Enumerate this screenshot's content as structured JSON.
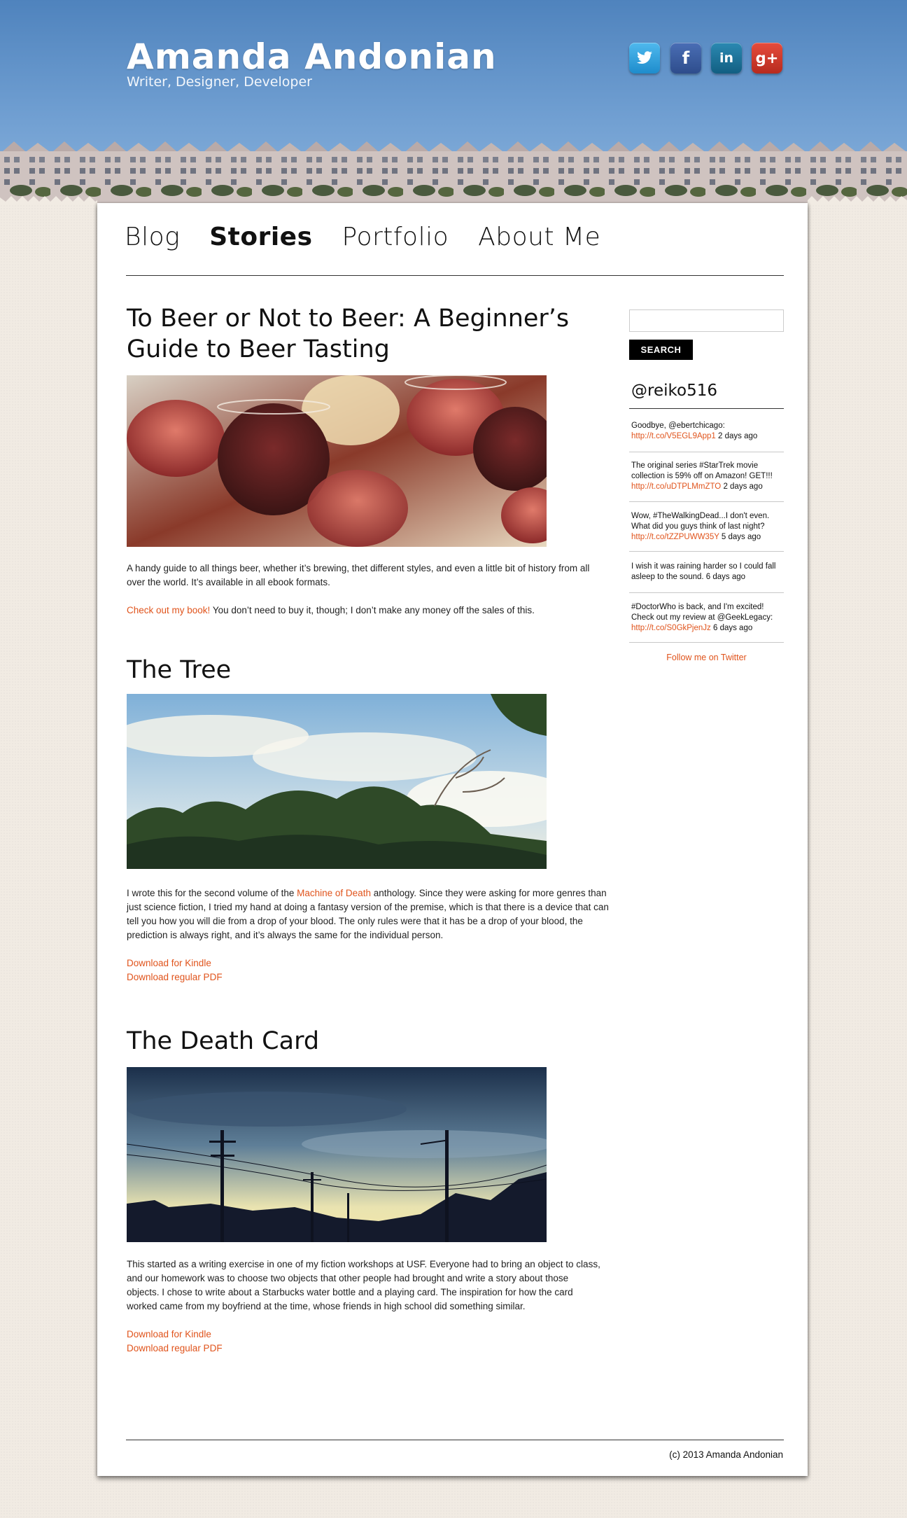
{
  "header": {
    "title": "Amanda Andonian",
    "tagline": "Writer, Designer, Developer",
    "social": [
      {
        "name": "twitter",
        "glyph": "🐦︎"
      },
      {
        "name": "facebook",
        "glyph": "f"
      },
      {
        "name": "linkedin",
        "glyph": "in"
      },
      {
        "name": "google-plus",
        "glyph": "g+"
      }
    ]
  },
  "nav": {
    "items": [
      {
        "label": "Blog"
      },
      {
        "label": "Stories"
      },
      {
        "label": "Portfolio"
      },
      {
        "label": "About Me"
      }
    ],
    "active": "Stories"
  },
  "posts": [
    {
      "title": "To Beer or Not to Beer: A Beginner’s Guide to Beer Tasting",
      "text": "A handy guide to all things beer, whether it’s brewing, thet different styles, and even a little bit of history from all over the world. It’s available in all ebook formats.",
      "cta_link": "Check out my book!",
      "cta_text": " You don’t need to buy it, though; I don’t make any money off the sales of this."
    },
    {
      "title": "The Tree",
      "text_before": "I wrote this for the second volume of the ",
      "text_link": "Machine of Death",
      "text_after": " anthology. Since they were asking for more genres than just science fiction, I tried my hand at doing a fantasy version of the premise, which is that there is a device that can tell you how you will die from a drop of your blood. The only rules were that it has be a drop of your blood, the prediction is always right, and it’s always the same for the individual person.",
      "download_kindle": "Download for Kindle",
      "download_pdf": "Download regular PDF"
    },
    {
      "title": "The Death Card",
      "text": "This started as a writing exercise in one of my fiction workshops at USF. Everyone had to bring an object to class, and our homework was to choose two objects that other people had brought and write a story about those objects. I chose to write about a Starbucks water bottle and a playing card. The inspiration for how the card worked came from my boyfriend at the time, whose friends in high school did something similar.",
      "download_kindle": "Download for Kindle",
      "download_pdf": "Download regular PDF"
    }
  ],
  "sidebar": {
    "search_placeholder": "",
    "search_button": "SEARCH",
    "twitter_handle": "@reiko516",
    "tweets": [
      {
        "text": "Goodbye, @ebertchicago: ",
        "link": "http://t.co/V5EGL9App1",
        "time": " 2 days ago"
      },
      {
        "text": "The original series #StarTrek movie collection is 59% off on Amazon! GET!!! ",
        "link": "http://t.co/uDTPLMmZTO",
        "time": " 2 days ago"
      },
      {
        "text": "Wow, #TheWalkingDead...I don't even. What did you guys think of last night? ",
        "link": "http://t.co/tZZPUWW35Y",
        "time": " 5 days ago"
      },
      {
        "text": "I wish it was raining harder so I could fall asleep to the sound.",
        "link": "",
        "time": " 6 days ago"
      },
      {
        "text": "#DoctorWho is back, and I'm excited! Check out my review at @GeekLegacy: ",
        "link": "http://t.co/S0GkPjenJz",
        "time": " 6 days ago"
      }
    ],
    "follow": "Follow me on Twitter"
  },
  "footer": {
    "copyright": "(c) 2013 Amanda Andonian"
  },
  "colors": {
    "accent": "#e0531b",
    "sky": "#5b8cc6",
    "page_bg": "#f1ebe3"
  }
}
